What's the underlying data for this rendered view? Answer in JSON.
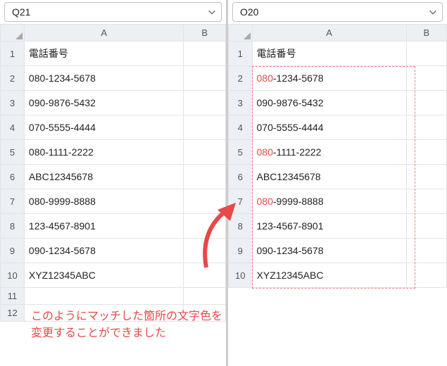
{
  "panes": {
    "left": {
      "namebox_value": "Q21",
      "columns": {
        "A": "A",
        "B": "B"
      },
      "header": "電話番号",
      "rows": [
        "080-1234-5678",
        "090-9876-5432",
        "070-5555-4444",
        "080-1111-2222",
        "ABC12345678",
        "080-9999-8888",
        "123-4567-8901",
        "090-1234-5678",
        "XYZ12345ABC"
      ],
      "row_nums": [
        1,
        2,
        3,
        4,
        5,
        6,
        7,
        8,
        9,
        10,
        11,
        12
      ]
    },
    "right": {
      "namebox_value": "O20",
      "columns": {
        "A": "A",
        "B": "B"
      },
      "header": "電話番号",
      "rows": [
        {
          "prefix": "080",
          "rest": "-1234-5678",
          "highlight": true
        },
        {
          "prefix": "",
          "rest": "090-9876-5432",
          "highlight": false
        },
        {
          "prefix": "",
          "rest": "070-5555-4444",
          "highlight": false
        },
        {
          "prefix": "080",
          "rest": "-1111-2222",
          "highlight": true
        },
        {
          "prefix": "",
          "rest": "ABC12345678",
          "highlight": false
        },
        {
          "prefix": "080",
          "rest": "-9999-8888",
          "highlight": true
        },
        {
          "prefix": "",
          "rest": "123-4567-8901",
          "highlight": false
        },
        {
          "prefix": "",
          "rest": "090-1234-5678",
          "highlight": false
        },
        {
          "prefix": "",
          "rest": "XYZ12345ABC",
          "highlight": false
        }
      ],
      "row_nums": [
        1,
        2,
        3,
        4,
        5,
        6,
        7,
        8,
        9,
        10
      ]
    }
  },
  "caption_line1": "このようにマッチした箇所の文字色を",
  "caption_line2": "変更することができました",
  "icons": {
    "chevron_down": "chevron-down-icon"
  }
}
